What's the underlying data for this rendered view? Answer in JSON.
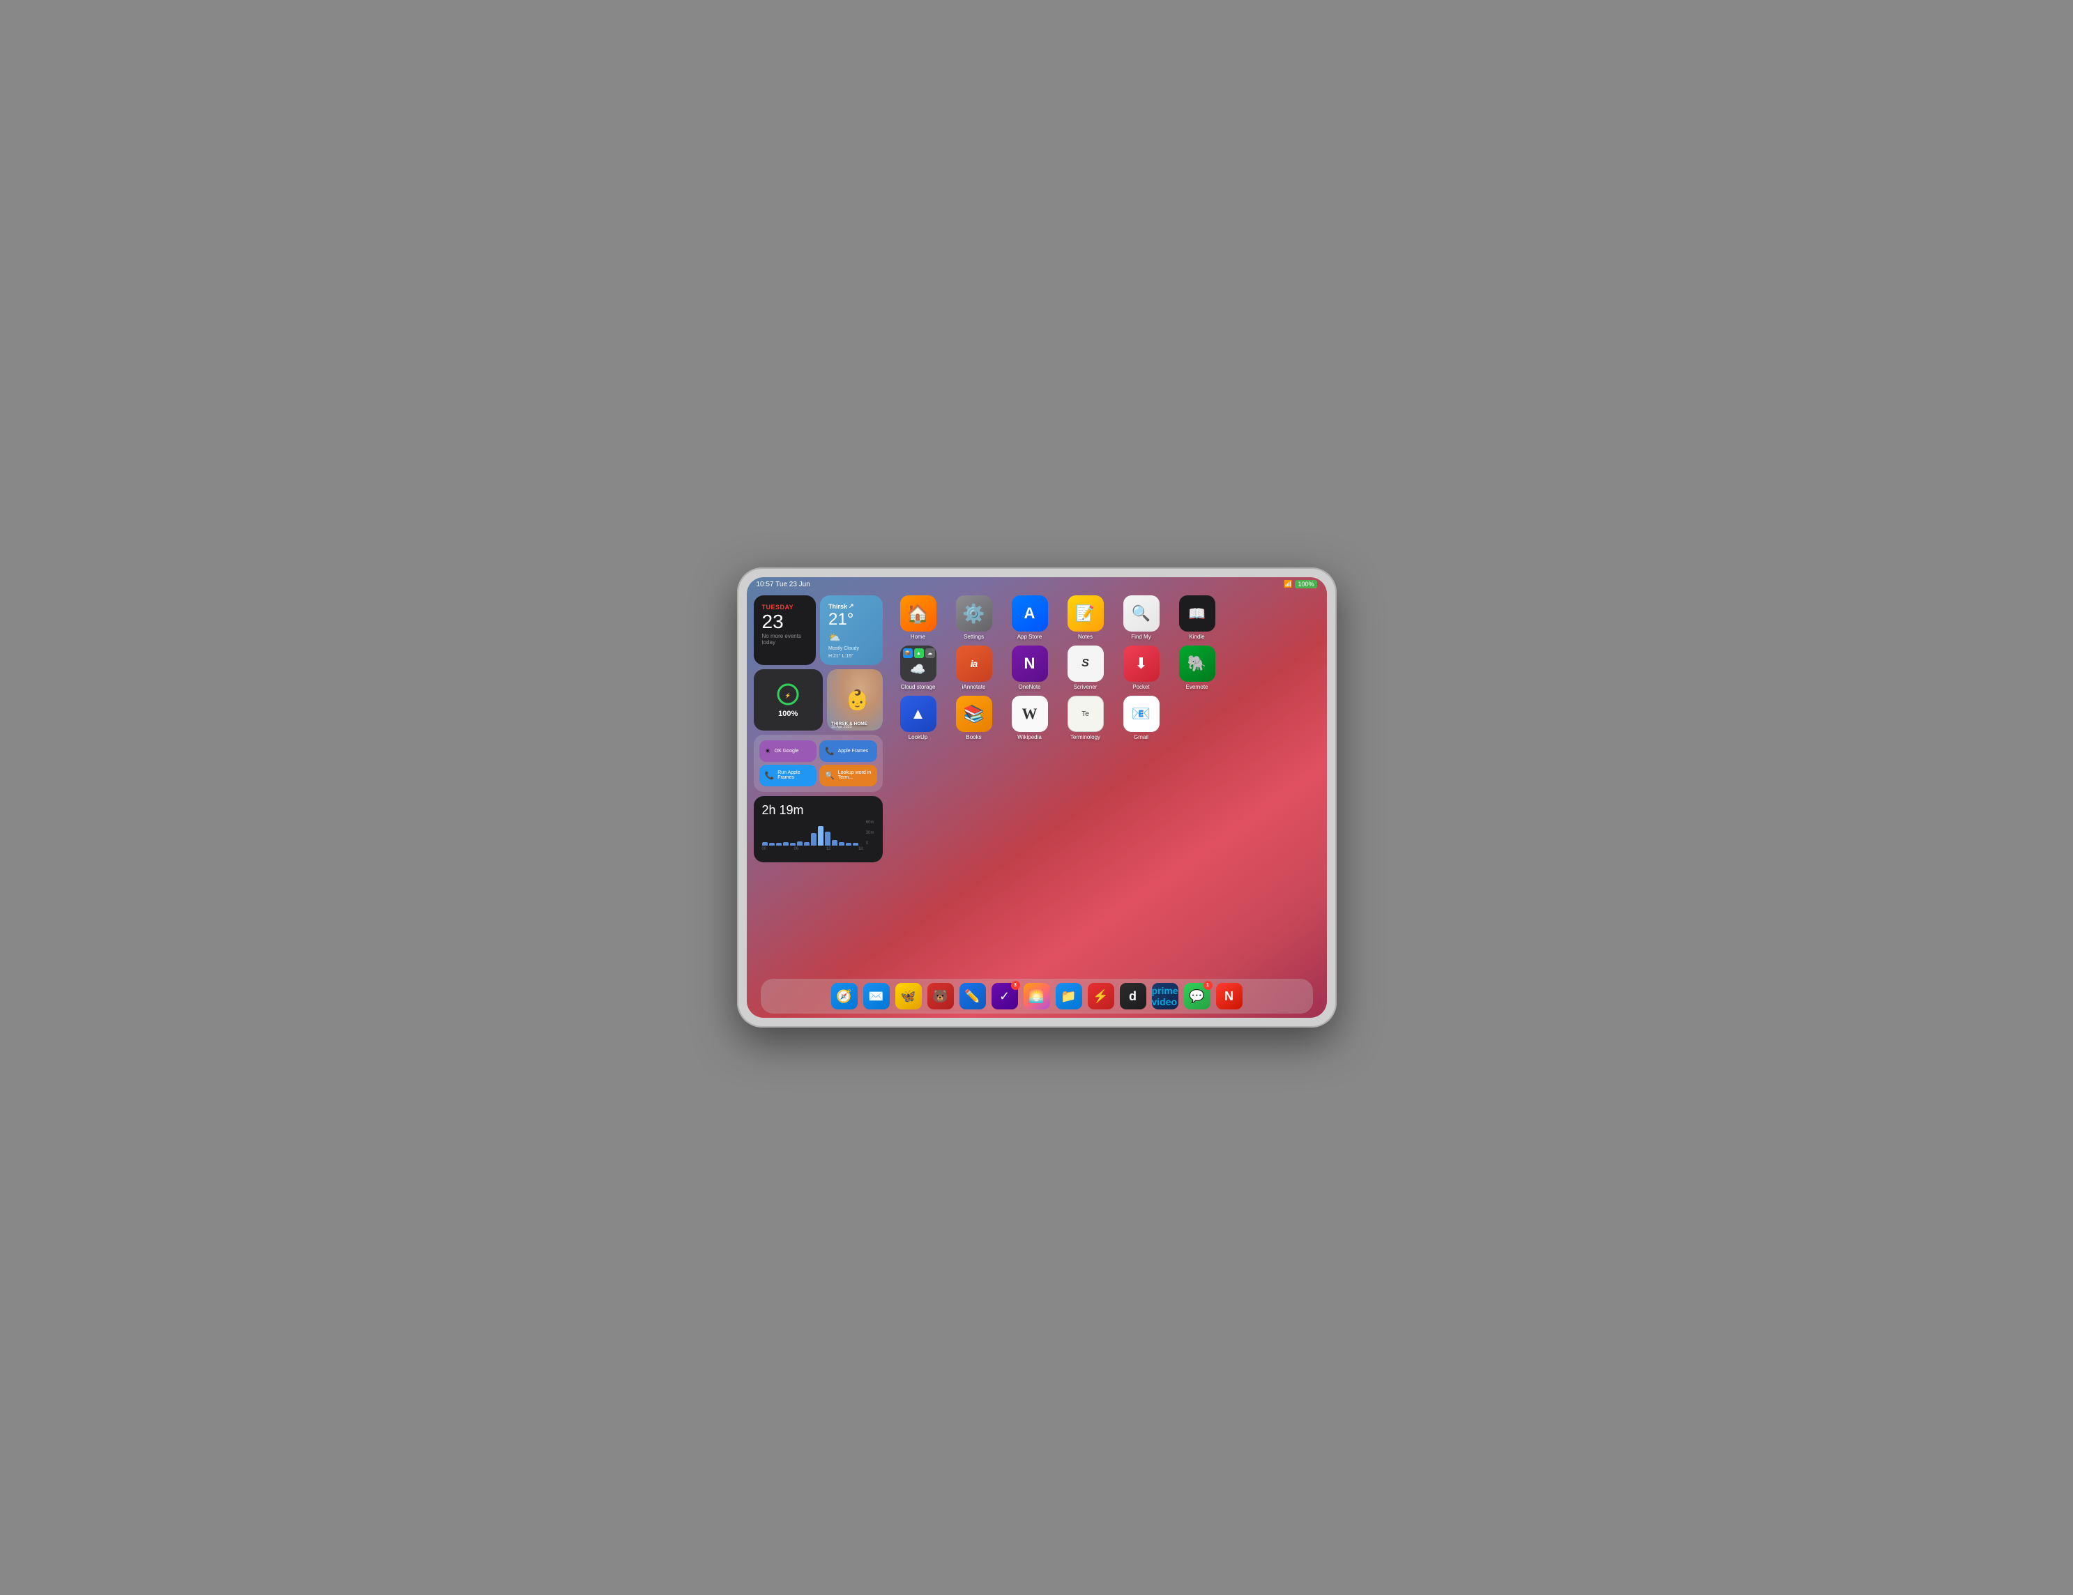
{
  "statusBar": {
    "time": "10:57",
    "date": "Tue 23 Jun",
    "wifi": "WiFi",
    "battery": "100%"
  },
  "widgets": {
    "calendar": {
      "dayLabel": "TUESDAY",
      "dayNumber": "23",
      "eventText": "No more events today"
    },
    "weather": {
      "location": "Thirsk",
      "temperature": "21°",
      "condition": "Mostly Cloudy",
      "highLow": "H:21° L:15°"
    },
    "battery": {
      "percentage": "100%"
    },
    "photo": {
      "text": "THIRSK & HOME",
      "date": "19 Apr 2020"
    },
    "siri": {
      "items": [
        {
          "label": "OK Google",
          "type": "purple"
        },
        {
          "label": "Apple Frames",
          "type": "blue"
        },
        {
          "label": "Run Apple Frames",
          "type": "blue2"
        },
        {
          "label": "Lookup word in Term...",
          "type": "orange"
        }
      ]
    },
    "screentime": {
      "duration": "2h 19m",
      "labels": [
        "00",
        "06",
        "12",
        "18"
      ],
      "gridLabels": [
        "60m",
        "30m",
        "0"
      ]
    }
  },
  "apps": {
    "row1": [
      {
        "name": "Home",
        "emoji": "🏠",
        "bg": "bg-orange"
      },
      {
        "name": "Settings",
        "emoji": "⚙️",
        "bg": "bg-gray"
      },
      {
        "name": "App Store",
        "emoji": "🅐",
        "bg": "bg-blue"
      },
      {
        "name": "Notes",
        "emoji": "📝",
        "bg": "bg-yellow"
      },
      {
        "name": "Find My",
        "emoji": "🔍",
        "bg": "bg-findmy"
      },
      {
        "name": "Kindle",
        "emoji": "📖",
        "bg": "bg-kindle"
      }
    ],
    "row2": [
      {
        "name": "Cloud storage",
        "emoji": "☁️",
        "bg": "bg-cloudstorage"
      },
      {
        "name": "iAnnotate",
        "emoji": "ia",
        "bg": "bg-ia"
      },
      {
        "name": "OneNote",
        "emoji": "N",
        "bg": "bg-onenote"
      },
      {
        "name": "Scrivener",
        "emoji": "S",
        "bg": "bg-scrivener"
      },
      {
        "name": "Pocket",
        "emoji": "⬇",
        "bg": "bg-pocket"
      },
      {
        "name": "Evernote",
        "emoji": "🐘",
        "bg": "bg-evernote"
      }
    ],
    "row3": [
      {
        "name": "LookUp",
        "emoji": "▲",
        "bg": "bg-lookup"
      },
      {
        "name": "Books",
        "emoji": "📚",
        "bg": "bg-books"
      },
      {
        "name": "Wikipedia",
        "emoji": "W",
        "bg": "bg-wikipedia"
      },
      {
        "name": "Terminology",
        "emoji": "Te",
        "bg": "bg-terminology"
      },
      {
        "name": "Gmail",
        "emoji": "M",
        "bg": "bg-gmail"
      }
    ]
  },
  "dock": {
    "items": [
      {
        "name": "Safari",
        "emoji": "🧭",
        "bg": "bg-safari",
        "badge": null
      },
      {
        "name": "Mail",
        "emoji": "✉️",
        "bg": "bg-mail",
        "badge": null
      },
      {
        "name": "Tes",
        "emoji": "🦋",
        "bg": "bg-tes",
        "badge": null
      },
      {
        "name": "Bear",
        "emoji": "🐻",
        "bg": "bg-bear",
        "badge": null
      },
      {
        "name": "GoodNotes",
        "emoji": "✏️",
        "bg": "bg-goodnotes",
        "badge": null
      },
      {
        "name": "OmniFocus",
        "emoji": "✓",
        "bg": "bg-omnifocus",
        "badge": "3"
      },
      {
        "name": "Photos",
        "emoji": "🌅",
        "bg": "bg-photos",
        "badge": null
      },
      {
        "name": "Files",
        "emoji": "📁",
        "bg": "bg-files",
        "badge": null
      },
      {
        "name": "Reeder",
        "emoji": "⚡",
        "bg": "bg-reeder",
        "badge": null
      },
      {
        "name": "Dash",
        "emoji": "d",
        "bg": "bg-dash",
        "badge": null
      },
      {
        "name": "Prime Video",
        "emoji": "▶",
        "bg": "bg-primevideo",
        "badge": null
      },
      {
        "name": "Messages",
        "emoji": "💬",
        "bg": "bg-messages",
        "badge": "1"
      },
      {
        "name": "News",
        "emoji": "N",
        "bg": "bg-news",
        "badge": null
      }
    ]
  },
  "pageIndicators": [
    {
      "active": true
    },
    {
      "active": false
    },
    {
      "active": false
    }
  ]
}
